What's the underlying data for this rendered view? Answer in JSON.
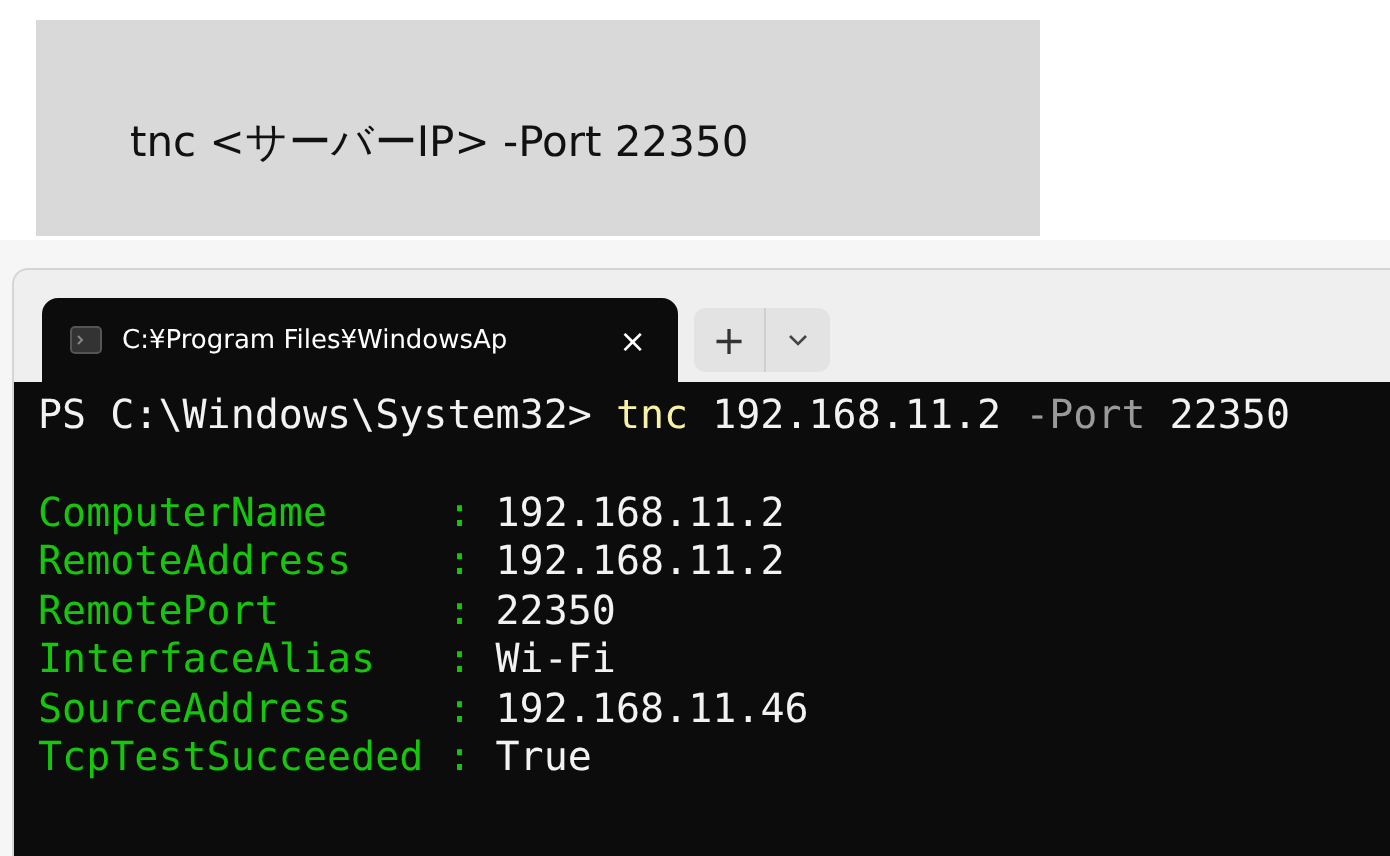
{
  "instruction": {
    "text": "tnc <サーバーIP> -Port 22350"
  },
  "terminal": {
    "tabs": [
      {
        "title": "C:¥Program Files¥WindowsAp",
        "close": "×",
        "selected": true
      }
    ],
    "new_tab": "+",
    "command": [
      {
        "text": "PS C:\\Windows\\System32>",
        "kind": "prompt"
      },
      {
        "text": "tnc",
        "kind": "command"
      },
      {
        "text": "192.168.11.2",
        "kind": "argument"
      },
      {
        "text": "-Port",
        "kind": "parameter"
      },
      {
        "text": "22350",
        "kind": "argument"
      }
    ],
    "output": [
      {
        "key": "ComputerName",
        "sep": ":",
        "value": "192.168.11.2"
      },
      {
        "key": "RemoteAddress",
        "sep": ":",
        "value": "192.168.11.2"
      },
      {
        "key": "RemotePort",
        "sep": ":",
        "value": "22350"
      },
      {
        "key": "InterfaceAlias",
        "sep": ":",
        "value": "Wi-Fi"
      },
      {
        "key": "SourceAddress",
        "sep": ":",
        "value": "192.168.11.46"
      },
      {
        "key": "TcpTestSucceeded",
        "sep": ":",
        "value": "True"
      }
    ]
  }
}
